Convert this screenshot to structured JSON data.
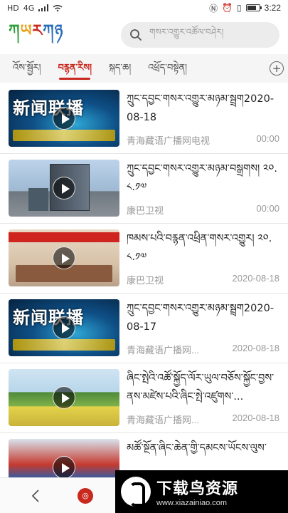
{
  "status_bar": {
    "left_icons": [
      "HD",
      "4G",
      "signal-icon",
      "wifi-icon"
    ],
    "time": "3:22"
  },
  "header": {
    "logo_parts": [
      "ཀ",
      "ཡ",
      "ར",
      "ཀཉ"
    ],
    "search_placeholder": "གསར་འགྱུར་འཚོལ་བཤེར།"
  },
  "tabs": [
    {
      "label": "འོས་སྦྱོར།",
      "active": false
    },
    {
      "label": "བརྙན་རིས།",
      "active": true
    },
    {
      "label": "སྐད་ཆ།",
      "active": false
    },
    {
      "label": "འཕྲོད་བསྟེན།",
      "active": false
    }
  ],
  "videos": [
    {
      "title": "ཀྲུང་དབྱང་གསར་འགྱུར་མཉམ་སྦྲག2020-08-18",
      "source": "青海藏语广播网电视",
      "right": "00:00",
      "thumb_style": "news",
      "thumb_text": "新闻联播"
    },
    {
      "title": "ཀྲུང་དབྱང་གསར་འགྱུར་མཉམ་བསྒྲགས། ༢༠.༨.༡༧",
      "source": "康巴卫视",
      "right": "00:00",
      "thumb_style": "building",
      "thumb_text": ""
    },
    {
      "title": "ཁམས་པའི་བརྙན་འཕྲིན་གསར་འགྱུར། ༢༠.༨.༡༧",
      "source": "康巴卫视",
      "right": "2020-08-18",
      "thumb_style": "event",
      "thumb_text": ""
    },
    {
      "title": "ཀྲུང་དབྱང་གསར་འགྱུར་མཉམ་སྦྲག2020-08-17",
      "source": "青海藏语广播网...",
      "right": "2020-08-18",
      "thumb_style": "news",
      "thumb_text": "新闻联播"
    },
    {
      "title": "ཞིང་སྤེའི་འཚོ་སྐྱོད་ལོར་ཡུལ་བཅོས་སྐྱོང་བྱས་ནས་མཛེས་པའི་ཞིང་སྤེ་འཛུགས་...",
      "source": "青海藏语广播网...",
      "right": "2020-08-18",
      "thumb_style": "field",
      "thumb_text": ""
    },
    {
      "title": "མཚོ་སྔོན་ཞིང་ཆེན་གྱི་དམངས་ཡོངས་ལུས་",
      "source": "",
      "right": "",
      "thumb_style": "crowd",
      "thumb_text": ""
    }
  ],
  "watermark": {
    "title": "下载鸟资源",
    "url": "www.xiazainiao.com"
  }
}
